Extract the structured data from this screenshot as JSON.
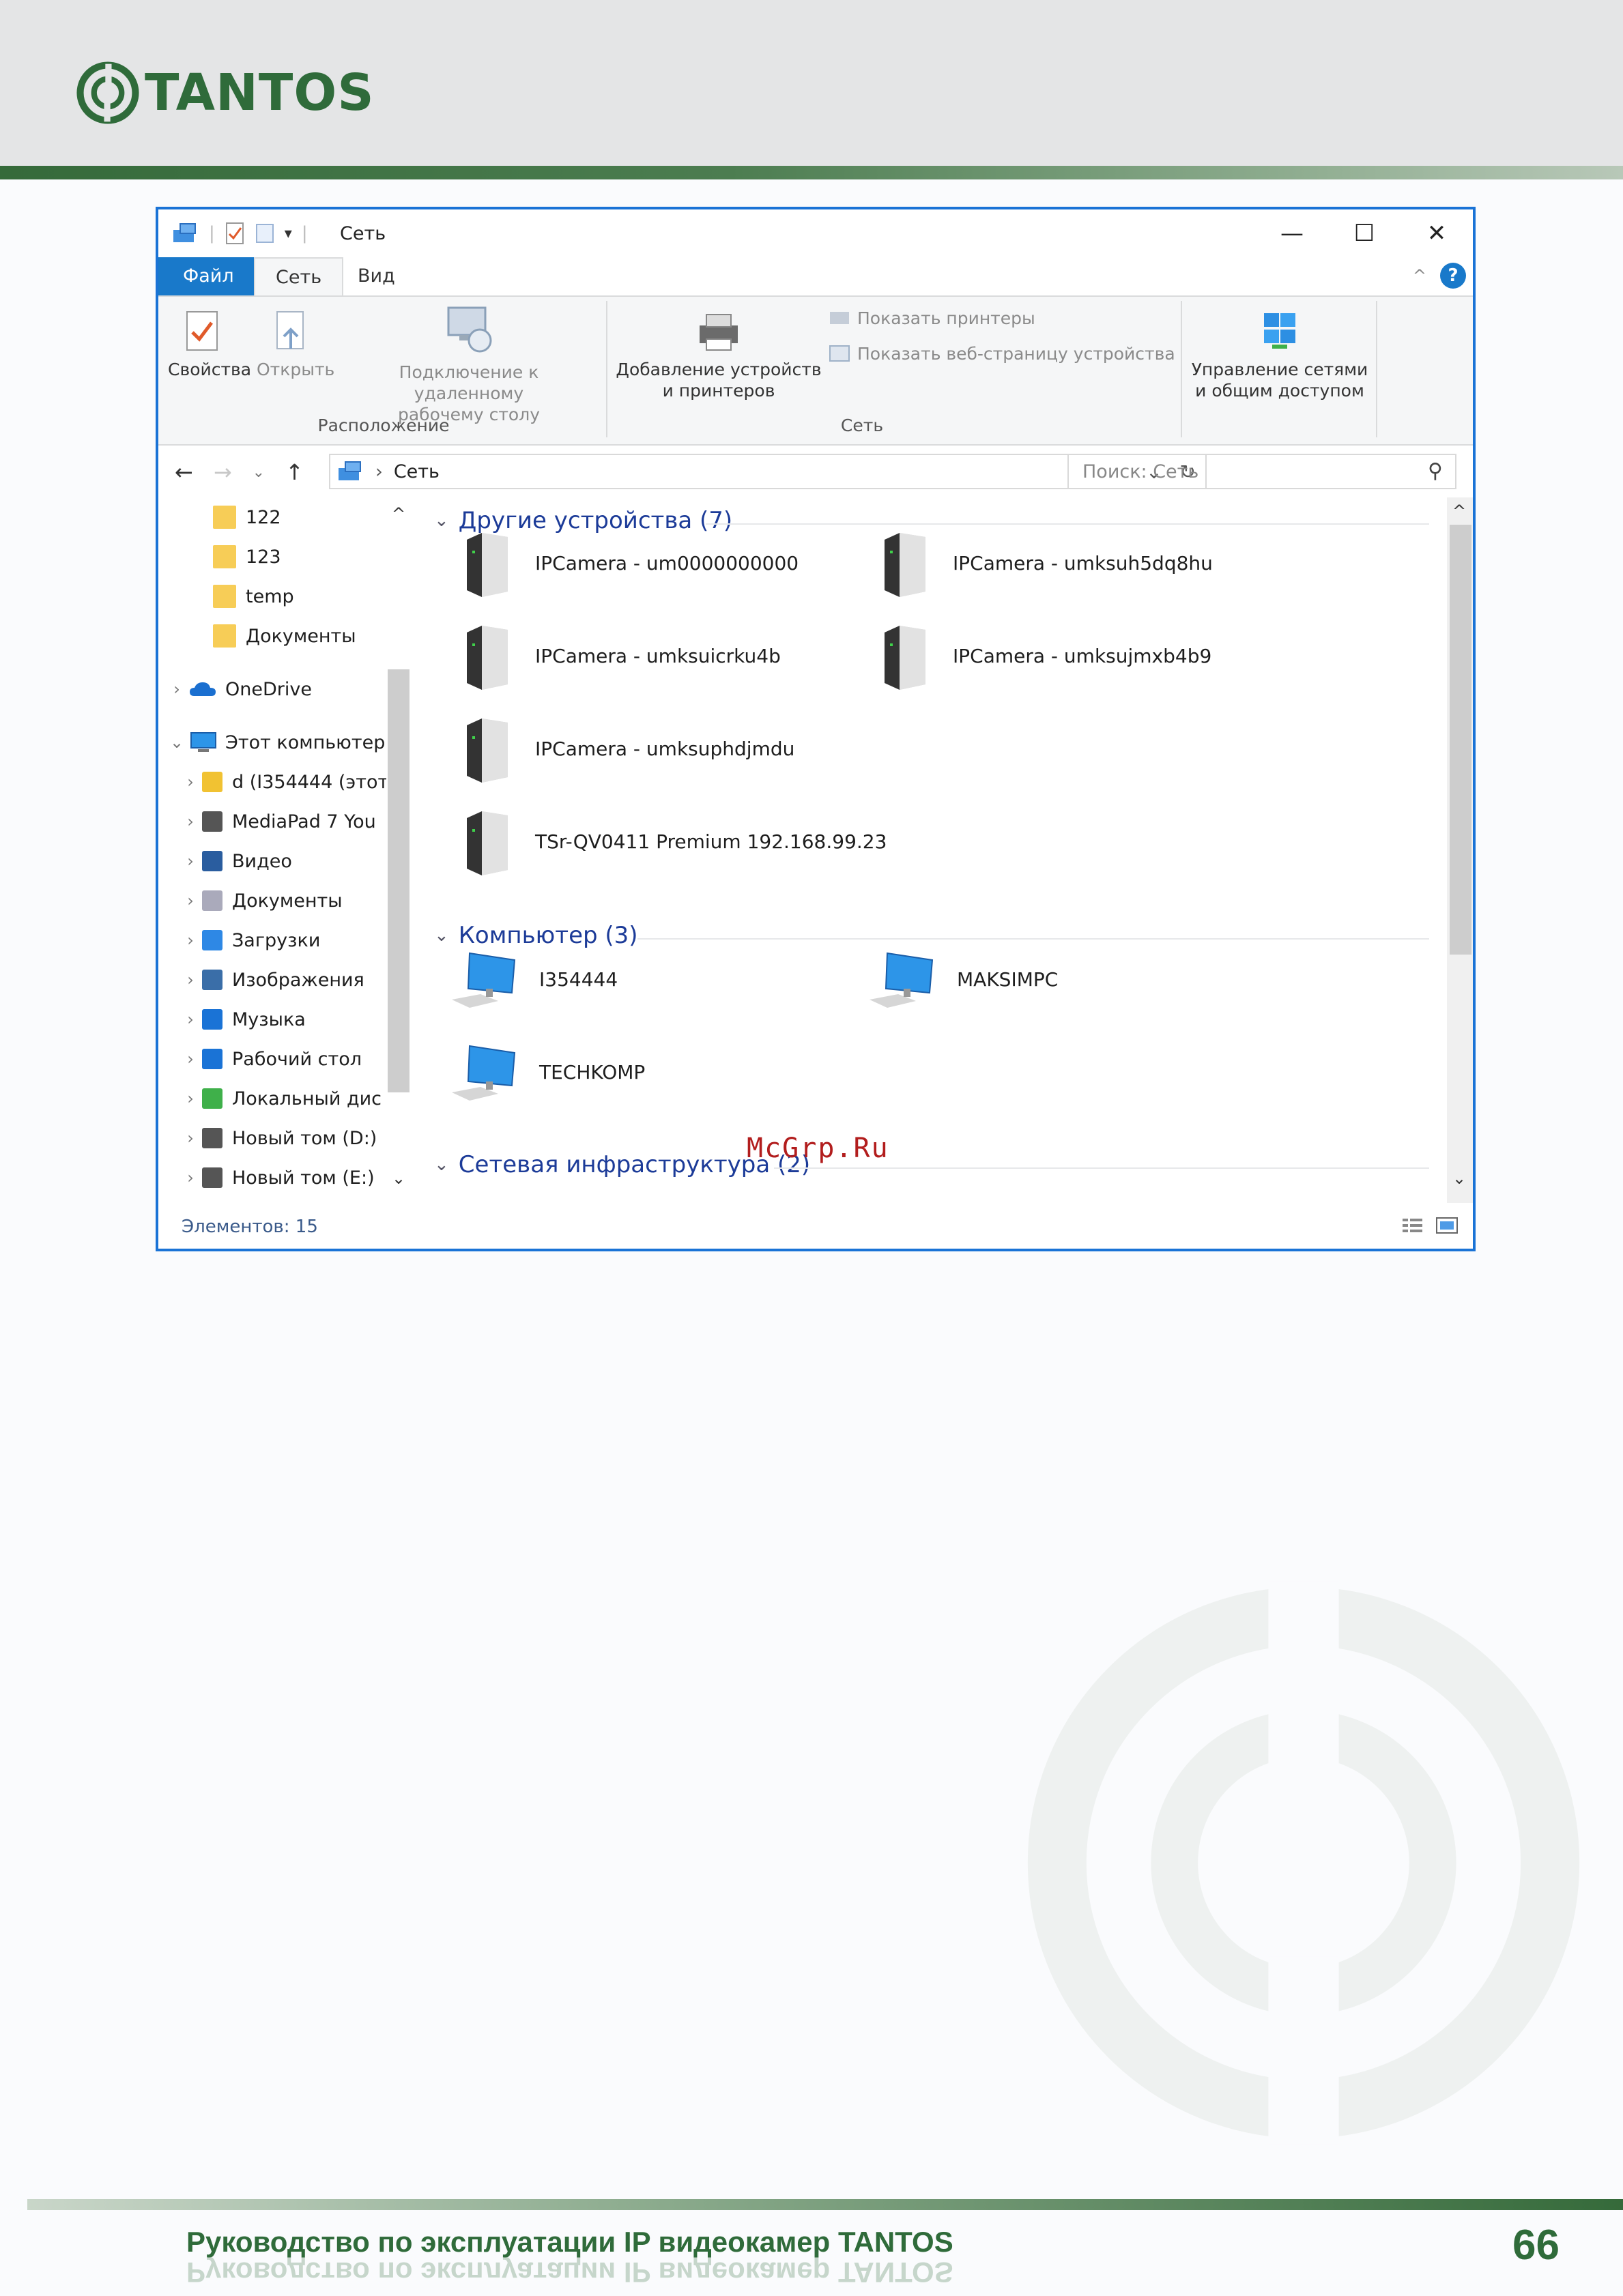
{
  "brand": {
    "name": "TANTOS",
    "color": "#2f6b3a"
  },
  "watermark_stamp": "McGrp.Ru",
  "footer": {
    "title": "Руководство по эксплуатации IP видеокамер TANTOS",
    "page_number": "66"
  },
  "window": {
    "title": "Сеть",
    "buttons": {
      "minimize": "—",
      "maximize": "☐",
      "close": "✕"
    },
    "tabs": [
      "Файл",
      "Сеть",
      "Вид"
    ],
    "ribbon": {
      "properties": "Свойства",
      "open": "Открыть",
      "remote_line1": "Подключение к удаленному",
      "remote_line2": "рабочему столу",
      "group_location": "Расположение",
      "add_devices_line1": "Добавление устройств",
      "add_devices_line2": "и принтеров",
      "show_printers": "Показать принтеры",
      "show_webpage": "Показать веб-страницу устройства",
      "group_network": "Сеть",
      "manage_line1": "Управление сетями",
      "manage_line2": "и общим доступом"
    },
    "address": {
      "path": "Сеть",
      "search_placeholder": "Поиск: Сеть"
    },
    "nav": {
      "folders": [
        "122",
        "123",
        "temp",
        "Документы"
      ],
      "onedrive": "OneDrive",
      "this_pc": "Этот компьютер",
      "pc_items": [
        "d (I354444 (этот",
        "MediaPad 7 You",
        "Видео",
        "Документы",
        "Загрузки",
        "Изображения",
        "Музыка",
        "Рабочий стол",
        "Локальный дис",
        "Новый том (D:)",
        "Новый том (E:)"
      ]
    },
    "groups": {
      "other": "Другие устройства (7)",
      "computer": "Компьютер (3)",
      "infra": "Сетевая инфраструктура (2)"
    },
    "devices": [
      "IPCamera - um0000000000",
      "IPCamera - umksuh5dq8hu",
      "IPCamera - umksuicrku4b",
      "IPCamera - umksujmxb4b9",
      "IPCamera - umksuphdjmdu",
      "TSr-QV0411 Premium 192.168.99.23"
    ],
    "computers": [
      "I354444",
      "MAKSIMPC",
      "TECHKOMP"
    ],
    "status": "Элементов: 15"
  }
}
